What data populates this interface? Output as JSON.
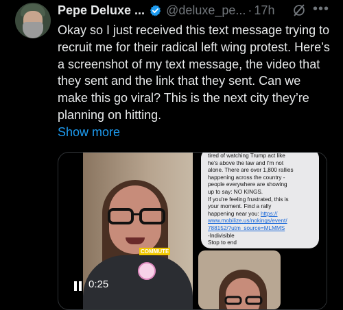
{
  "tweet": {
    "author_name": "Pepe Deluxe ...",
    "handle": "@deluxe_pe...",
    "separator": "·",
    "time": "17h",
    "more_glyph": "•••",
    "text": "Okay so I just received this text message trying to recruit me for their radical left wing protest. Here’s a screenshot of my text message, the video that they sent and the link that they sent. Can we make this go viral? This is the next city they’re planning on hitting.",
    "show_more": "Show more"
  },
  "media": {
    "video_caption": "COMMUTE",
    "duration": "0:25",
    "message_lines": [
      "tired of watching Trump act like",
      "he's above the law and I'm not",
      "alone. There are over 1,800 rallies",
      "happening across the country -",
      "people everywhere are showing",
      "up to say: NO KINGS.",
      "If you're feeling frustrated, this is",
      "your moment. Find a rally",
      "happening near you:"
    ],
    "message_link_lines": [
      "https://",
      "www.mobilize.us/nokings/event/",
      "788152/?utm_source=MLMMS"
    ],
    "message_tail": [
      "-Indivisible",
      "Stop to end"
    ]
  },
  "icons": {
    "verified": "verified-badge-icon",
    "grok": "grok-icon",
    "more": "more-options-icon",
    "pause": "pause-icon"
  },
  "colors": {
    "background": "#000000",
    "text": "#e7e9ea",
    "muted": "#71767b",
    "link": "#1d9bf0",
    "verified": "#1d9bf0"
  }
}
